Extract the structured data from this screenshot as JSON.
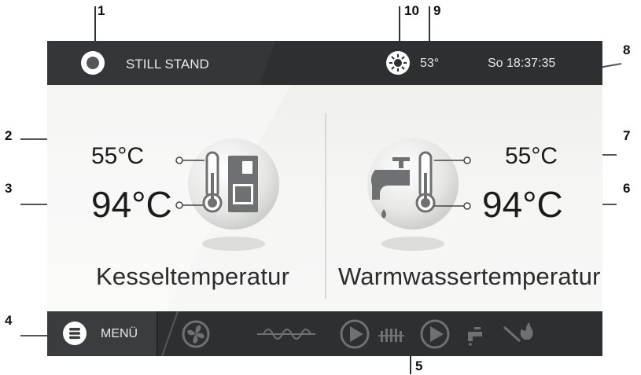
{
  "callouts": [
    "1",
    "2",
    "3",
    "4",
    "5",
    "6",
    "7",
    "8",
    "9",
    "10"
  ],
  "topbar": {
    "status_text": "STILL STAND",
    "status_icon": "status-dot-icon",
    "weather_icon": "sun-icon",
    "outdoor_temp": "53°",
    "datetime": "So 18:37:35"
  },
  "left_panel": {
    "set_temp": "55°C",
    "actual_temp": "94°C",
    "label": "Kesseltemperatur",
    "icon": "boiler-thermometer-icon"
  },
  "right_panel": {
    "set_temp": "55°C",
    "actual_temp": "94°C",
    "label": "Warmwassertemperatur",
    "icon": "tap-thermometer-icon"
  },
  "bottombar": {
    "menu_label": "MENÜ",
    "menu_icon": "menu-icon",
    "status_icons": [
      "fan-icon",
      "auger-icon",
      "pump-icon",
      "radiator-icon",
      "pump-icon",
      "tap-icon",
      "fire-icon"
    ]
  },
  "colors": {
    "bar_bg": "#2e2f31",
    "screen_bg": "#f2f2f0",
    "text_dark": "#1b1b1b",
    "icon_gray": "#6f7072"
  }
}
